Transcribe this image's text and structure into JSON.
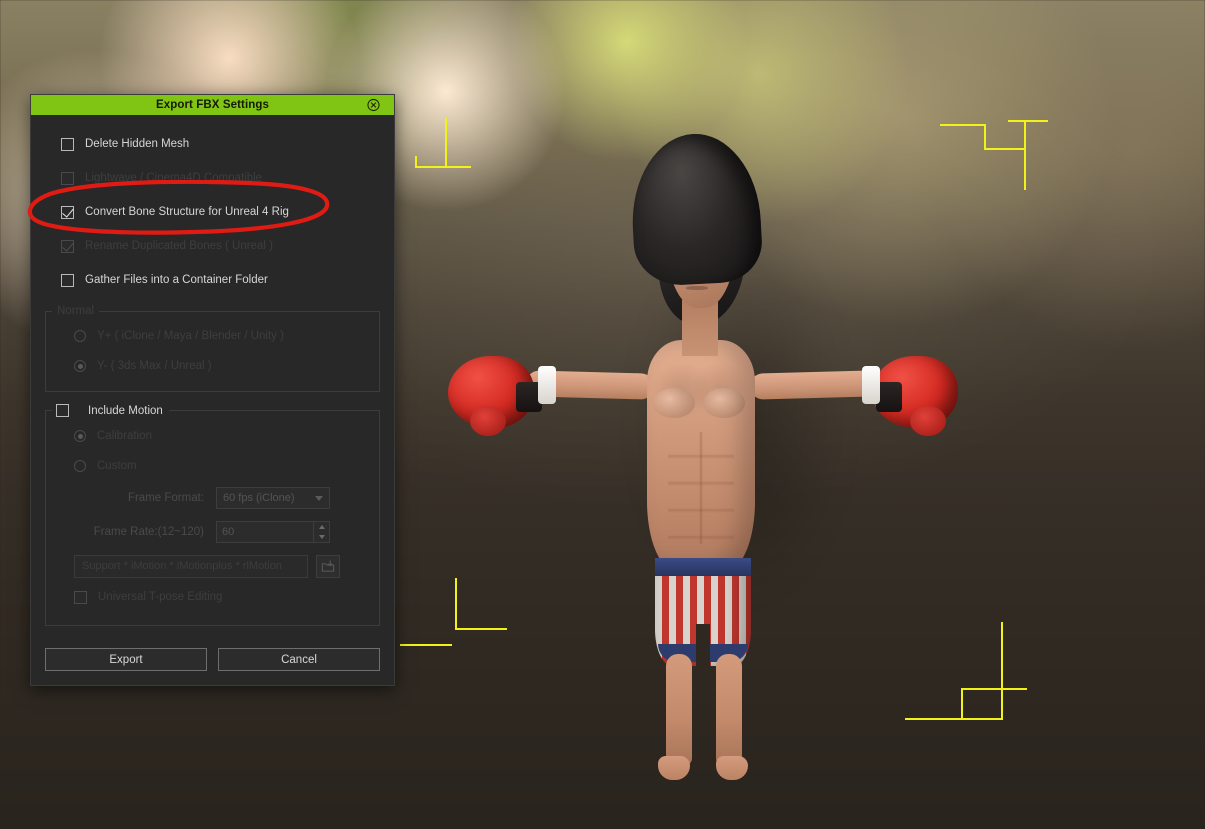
{
  "app": {
    "background_scene": "3d-viewport-blurred-bokeh",
    "character": "cartoon-boxer-t-pose"
  },
  "colors": {
    "titlebar_green": "#80c414",
    "dialog_bg": "#282828",
    "label_enabled": "#d6d6d6",
    "label_disabled": "#3e3e3e",
    "annotation_red": "#e01b14",
    "gizmo_yellow": "#f2f21a",
    "glove_red": "#d42a22"
  },
  "dialog": {
    "title": "Export FBX Settings",
    "close_icon": "close-circle-icon",
    "checkboxes": [
      {
        "label": "Delete Hidden Mesh",
        "checked": false,
        "enabled": true
      },
      {
        "label": "Lightwave / Cinema4D Compatible",
        "checked": false,
        "enabled": false
      },
      {
        "label": "Convert Bone Structure for Unreal 4 Rig",
        "checked": true,
        "enabled": true,
        "highlighted": true
      },
      {
        "label": "Rename Duplicated Bones ( Unreal )",
        "checked": true,
        "enabled": false
      },
      {
        "label": "Gather Files into a Container Folder",
        "checked": false,
        "enabled": true
      }
    ],
    "normal_group": {
      "legend": "Normal",
      "enabled": false,
      "options": [
        {
          "label": "Y+ ( iClone / Maya / Blender / Unity )",
          "selected": false
        },
        {
          "label": "Y- ( 3ds Max / Unreal )",
          "selected": true
        }
      ]
    },
    "motion_group": {
      "legend": "Include Motion",
      "checked": false,
      "enabled": true,
      "options": [
        {
          "label": "Calibration",
          "selected": true
        },
        {
          "label": "Custom",
          "selected": false
        }
      ],
      "frame_format": {
        "label": "Frame Format:",
        "value": "60 fps (iClone)",
        "caret_icon": "chevron-down-icon"
      },
      "frame_rate": {
        "label": "Frame Rate:(12~120)",
        "value": "60",
        "spinner_up_icon": "caret-up-icon",
        "spinner_down_icon": "caret-down-icon"
      },
      "motion_path": {
        "placeholder": "Support * iMotion * iMotionplus * rlMotion",
        "value": "",
        "browse_icon": "load-folder-icon"
      },
      "tpose": {
        "label": "Universal T-pose Editing",
        "checked": false,
        "enabled": false
      }
    },
    "buttons": {
      "export": "Export",
      "cancel": "Cancel"
    }
  }
}
